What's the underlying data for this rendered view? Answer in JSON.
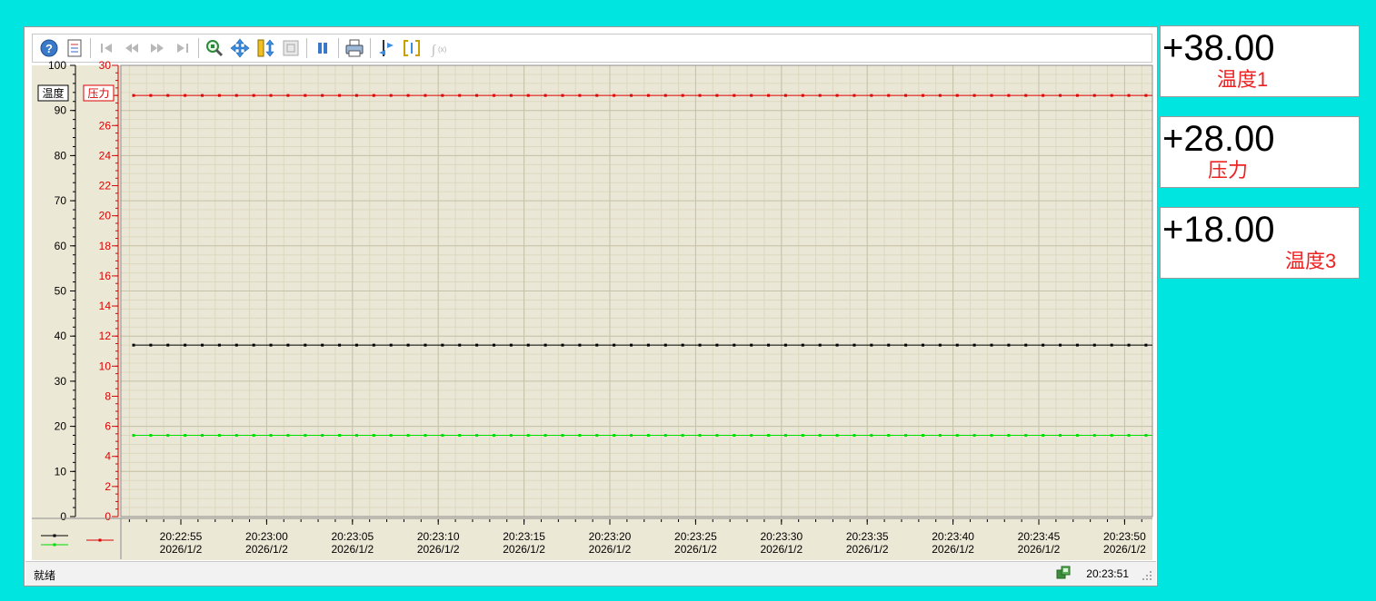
{
  "toolbar": {
    "buttons": [
      {
        "icon": "help-icon"
      },
      {
        "icon": "export-icon"
      },
      {
        "sep": true
      },
      {
        "icon": "first-icon"
      },
      {
        "icon": "rewind-icon"
      },
      {
        "icon": "forward-icon"
      },
      {
        "icon": "last-icon"
      },
      {
        "sep": true
      },
      {
        "icon": "zoom-icon"
      },
      {
        "icon": "pan-icon"
      },
      {
        "icon": "vertical-scale-icon"
      },
      {
        "icon": "fit-icon"
      },
      {
        "sep": true
      },
      {
        "icon": "pause-icon"
      },
      {
        "sep": true
      },
      {
        "icon": "print-icon"
      },
      {
        "sep": true
      },
      {
        "icon": "axis-swap-icon"
      },
      {
        "icon": "cursor-range-icon"
      },
      {
        "icon": "formula-icon"
      }
    ]
  },
  "chart_data": {
    "type": "line",
    "grid": true,
    "left_axis": {
      "label": "温度",
      "color": "#000000",
      "ylim": [
        0,
        100
      ],
      "ticks": [
        0,
        10,
        20,
        30,
        40,
        50,
        60,
        70,
        80,
        90,
        100
      ]
    },
    "right_axis": {
      "label": "压力",
      "color": "#dd0000",
      "ylim": [
        0,
        30
      ],
      "ticks": [
        0,
        2,
        4,
        6,
        8,
        10,
        12,
        14,
        16,
        18,
        20,
        22,
        24,
        26,
        28,
        30
      ]
    },
    "x_ticks": [
      {
        "time": "20:22:55",
        "date": "2026/1/2"
      },
      {
        "time": "20:23:00",
        "date": "2026/1/2"
      },
      {
        "time": "20:23:05",
        "date": "2026/1/2"
      },
      {
        "time": "20:23:10",
        "date": "2026/1/2"
      },
      {
        "time": "20:23:15",
        "date": "2026/1/2"
      },
      {
        "time": "20:23:20",
        "date": "2026/1/2"
      },
      {
        "time": "20:23:25",
        "date": "2026/1/2"
      },
      {
        "time": "20:23:30",
        "date": "2026/1/2"
      },
      {
        "time": "20:23:35",
        "date": "2026/1/2"
      },
      {
        "time": "20:23:40",
        "date": "2026/1/2"
      },
      {
        "time": "20:23:45",
        "date": "2026/1/2"
      },
      {
        "time": "20:23:50",
        "date": "2026/1/2"
      }
    ],
    "series": [
      {
        "axis": "left",
        "color": "#000000",
        "value": 38
      },
      {
        "axis": "left",
        "color": "#00dd00",
        "value": 18
      },
      {
        "axis": "right",
        "color": "#dd0000",
        "value": 28
      }
    ]
  },
  "status": {
    "left": "就绪",
    "time": "20:23:51"
  },
  "cards": [
    {
      "value": "+38.00",
      "label": "温度1"
    },
    {
      "value": "+28.00",
      "label": "压力"
    },
    {
      "value": "+18.00",
      "label": "温度3"
    }
  ]
}
